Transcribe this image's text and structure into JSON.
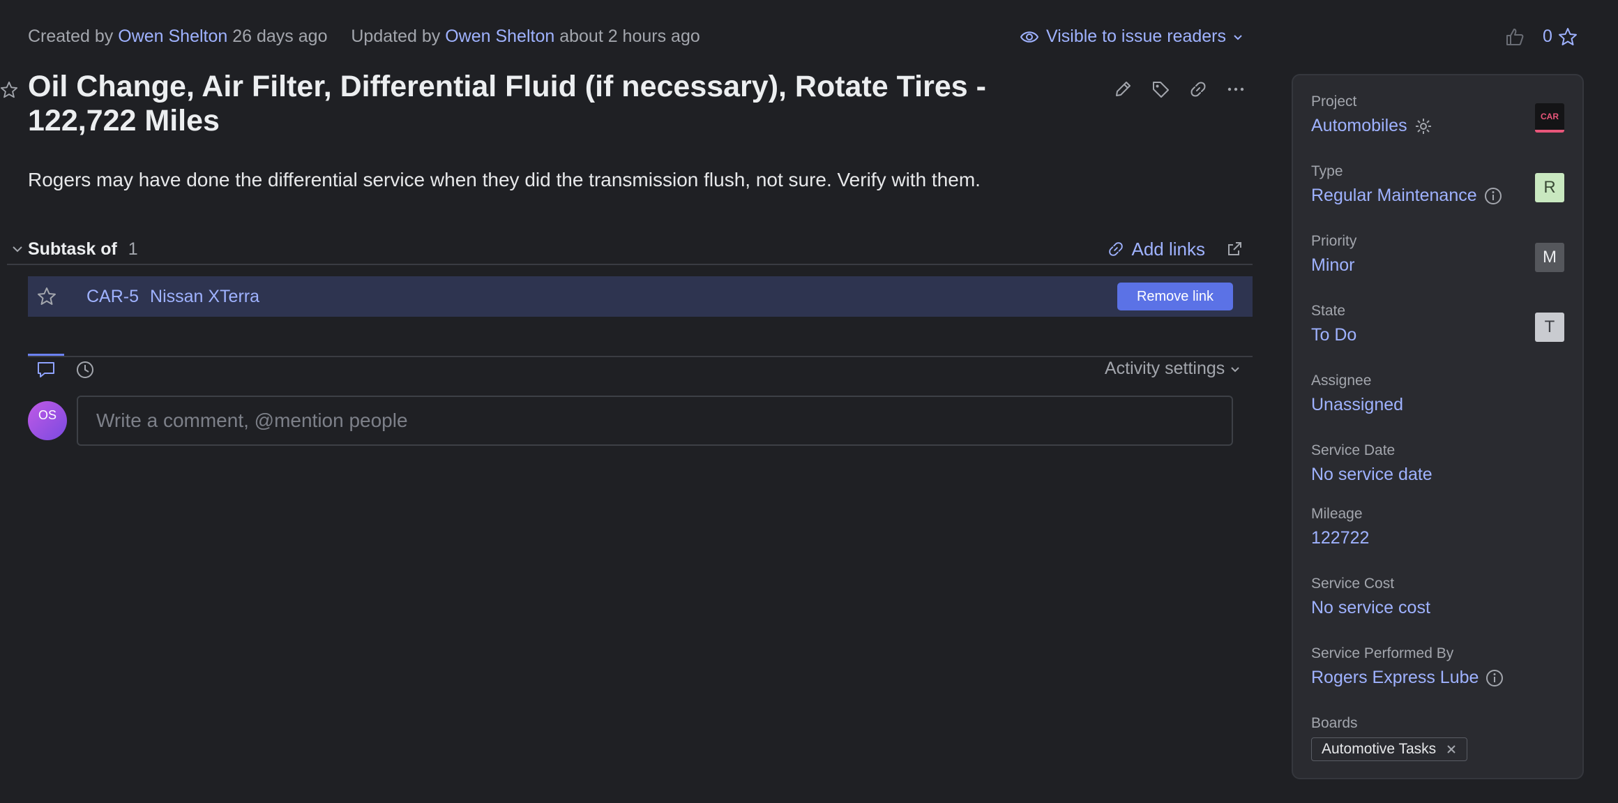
{
  "meta": {
    "created_prefix": "Created by",
    "created_by": "Owen Shelton",
    "created_when": "26 days ago",
    "updated_prefix": "Updated by",
    "updated_by": "Owen Shelton",
    "updated_when": "about 2 hours ago",
    "visibility": "Visible to issue readers"
  },
  "votes": {
    "count": "0"
  },
  "issue": {
    "title": "Oil Change, Air Filter, Differential Fluid (if necessary), Rotate Tires - 122,722 Miles",
    "description": "Rogers may have done the differential service when they did the transmission flush, not sure. Verify with them."
  },
  "subtask": {
    "label": "Subtask of",
    "count": "1",
    "add_links": "Add links",
    "row": {
      "key": "CAR-5",
      "summary": "Nissan XTerra",
      "remove_label": "Remove link"
    }
  },
  "activity": {
    "settings_label": "Activity settings",
    "comment_placeholder": "Write a comment, @mention people",
    "avatar_initials": "OS"
  },
  "panel": {
    "project": {
      "label": "Project",
      "value": "Automobiles",
      "badge": "CAR"
    },
    "type": {
      "label": "Type",
      "value": "Regular Maintenance",
      "badge": "R"
    },
    "priority": {
      "label": "Priority",
      "value": "Minor",
      "badge": "M"
    },
    "state": {
      "label": "State",
      "value": "To Do",
      "badge": "T"
    },
    "assignee": {
      "label": "Assignee",
      "value": "Unassigned"
    },
    "service_date": {
      "label": "Service Date",
      "value": "No service date"
    },
    "mileage": {
      "label": "Mileage",
      "value": "122722"
    },
    "service_cost": {
      "label": "Service Cost",
      "value": "No service cost"
    },
    "performed_by": {
      "label": "Service Performed By",
      "value": "Rogers Express Lube"
    },
    "boards": {
      "label": "Boards",
      "chip": "Automotive Tasks"
    }
  },
  "colors": {
    "background": "#1f2024",
    "link": "#9fb2ff",
    "accent": "#5b72e6",
    "panel": "#2a2b30",
    "type_badge": "#c9e8c0",
    "priority_badge": "#55575c",
    "state_badge": "#c9cbd0"
  }
}
